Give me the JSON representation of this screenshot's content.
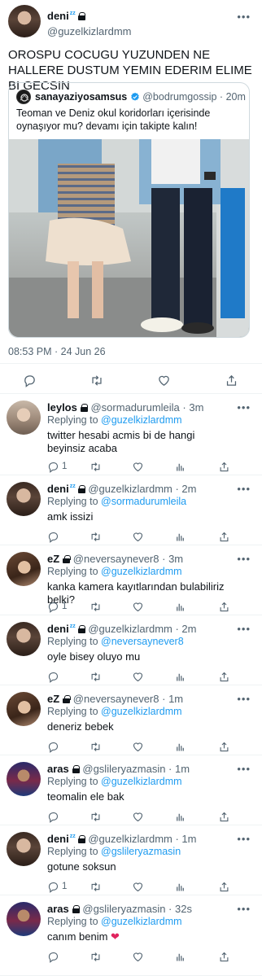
{
  "main_tweet": {
    "name": "deni",
    "name_suffix": "zz",
    "handle": "@guzelkizlardmm",
    "text": "OROSPU COCUGU YUZUNDEN NE HALLERE DUSTUM YEMIN EDERIM ELIME BI GECSIN",
    "quote": {
      "name": "sanayaziyosamsus",
      "handle": "@bodrumgossip",
      "time": "20m",
      "text": "Teoman ve Deniz okul koridorları içerisinde oynaşıyor mu? devamı için takipte kalın!"
    },
    "timestamp": "08:53 PM · 24 Jun 26"
  },
  "replying_label": "Replying to",
  "replies": [
    {
      "name": "leylos",
      "suffix": "",
      "handle": "@sormadurumleila",
      "time": "3m",
      "reply_to": "@guzelkizlardmm",
      "text": "twitter hesabi acmis bi de hangi beyinsiz acaba",
      "reply_count": "1"
    },
    {
      "name": "deni",
      "suffix": "zz",
      "handle": "@guzelkizlardmm",
      "time": "2m",
      "reply_to": "@sormadurumleila",
      "text": "amk issizi",
      "reply_count": ""
    },
    {
      "name": "eZ",
      "suffix": "",
      "handle": "@neversaynever8",
      "time": "3m",
      "reply_to": "@guzelkizlardmm",
      "text": "kanka kamera kayıtlarından bulabiliriz belki?",
      "reply_count": "1"
    },
    {
      "name": "deni",
      "suffix": "zz",
      "handle": "@guzelkizlardmm",
      "time": "2m",
      "reply_to": "@neversaynever8",
      "text": "oyle bisey oluyo mu",
      "reply_count": ""
    },
    {
      "name": "eZ",
      "suffix": "",
      "handle": "@neversaynever8",
      "time": "1m",
      "reply_to": "@guzelkizlardmm",
      "text": "deneriz bebek",
      "reply_count": ""
    },
    {
      "name": "aras",
      "suffix": "",
      "handle": "@gslileryazmasin",
      "time": "1m",
      "reply_to": "@guzelkizlardmm",
      "text": "teomalin ele bak",
      "reply_count": ""
    },
    {
      "name": "deni",
      "suffix": "zz",
      "handle": "@guzelkizlardmm",
      "time": "1m",
      "reply_to": "@gslileryazmasin",
      "text": "gotune soksun",
      "reply_count": "1"
    },
    {
      "name": "aras",
      "suffix": "",
      "handle": "@gslileryazmasin",
      "time": "32s",
      "reply_to": "@guzelkizlardmm",
      "text": "canım benim ❤️",
      "reply_count": ""
    }
  ],
  "colors": {
    "accent": "#1d9bf0",
    "text": "#0f1419",
    "muted": "#536471",
    "divider": "#eff3f4",
    "heart": "#e0245e"
  },
  "icons": [
    "reply-icon",
    "retweet-icon",
    "like-icon",
    "views-icon",
    "share-icon",
    "lock-icon",
    "verified-icon",
    "more-icon"
  ]
}
